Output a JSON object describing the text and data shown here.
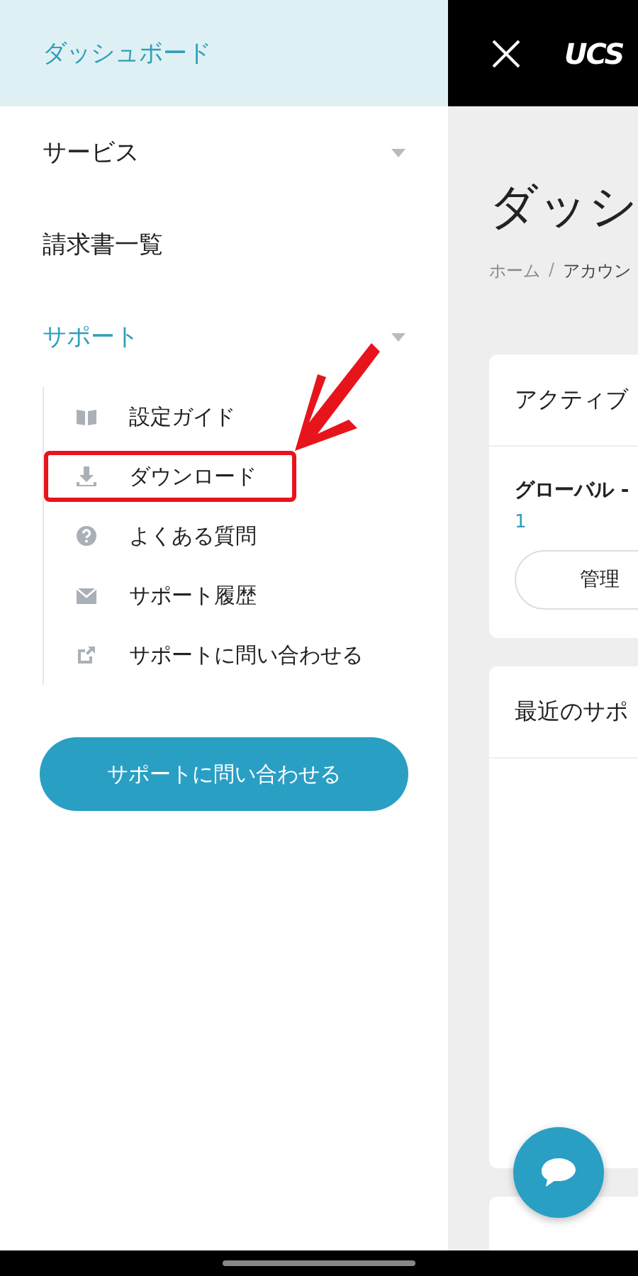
{
  "sidebar": {
    "items": [
      {
        "label": "ダッシュボード",
        "selected": true,
        "kind": "link"
      },
      {
        "label": "サービス",
        "selected": false,
        "kind": "group",
        "expanded": false
      },
      {
        "label": "請求書一覧",
        "selected": false,
        "kind": "link"
      },
      {
        "label": "サポート",
        "selected": false,
        "kind": "group",
        "expanded": true,
        "children": [
          {
            "label": "設定ガイド",
            "kind": "guide",
            "highlighted": false
          },
          {
            "label": "ダウンロード",
            "kind": "download",
            "highlighted": true
          },
          {
            "label": "よくある質問",
            "kind": "faq",
            "highlighted": false
          },
          {
            "label": "サポート履歴",
            "kind": "history",
            "highlighted": false
          },
          {
            "label": "サポートに問い合わせる",
            "kind": "external",
            "highlighted": false
          }
        ]
      }
    ],
    "support_button": "サポートに問い合わせる"
  },
  "header": {
    "logo": "UCS"
  },
  "main": {
    "title": "ダッシ",
    "breadcrumb": [
      "ホーム",
      "アカウン"
    ],
    "breadcrumb_separator": "/",
    "cards": [
      {
        "title": "アクティブ",
        "service": "グローバル -",
        "number": "1",
        "button": "管理"
      },
      {
        "title": "最近のサポ"
      }
    ]
  }
}
